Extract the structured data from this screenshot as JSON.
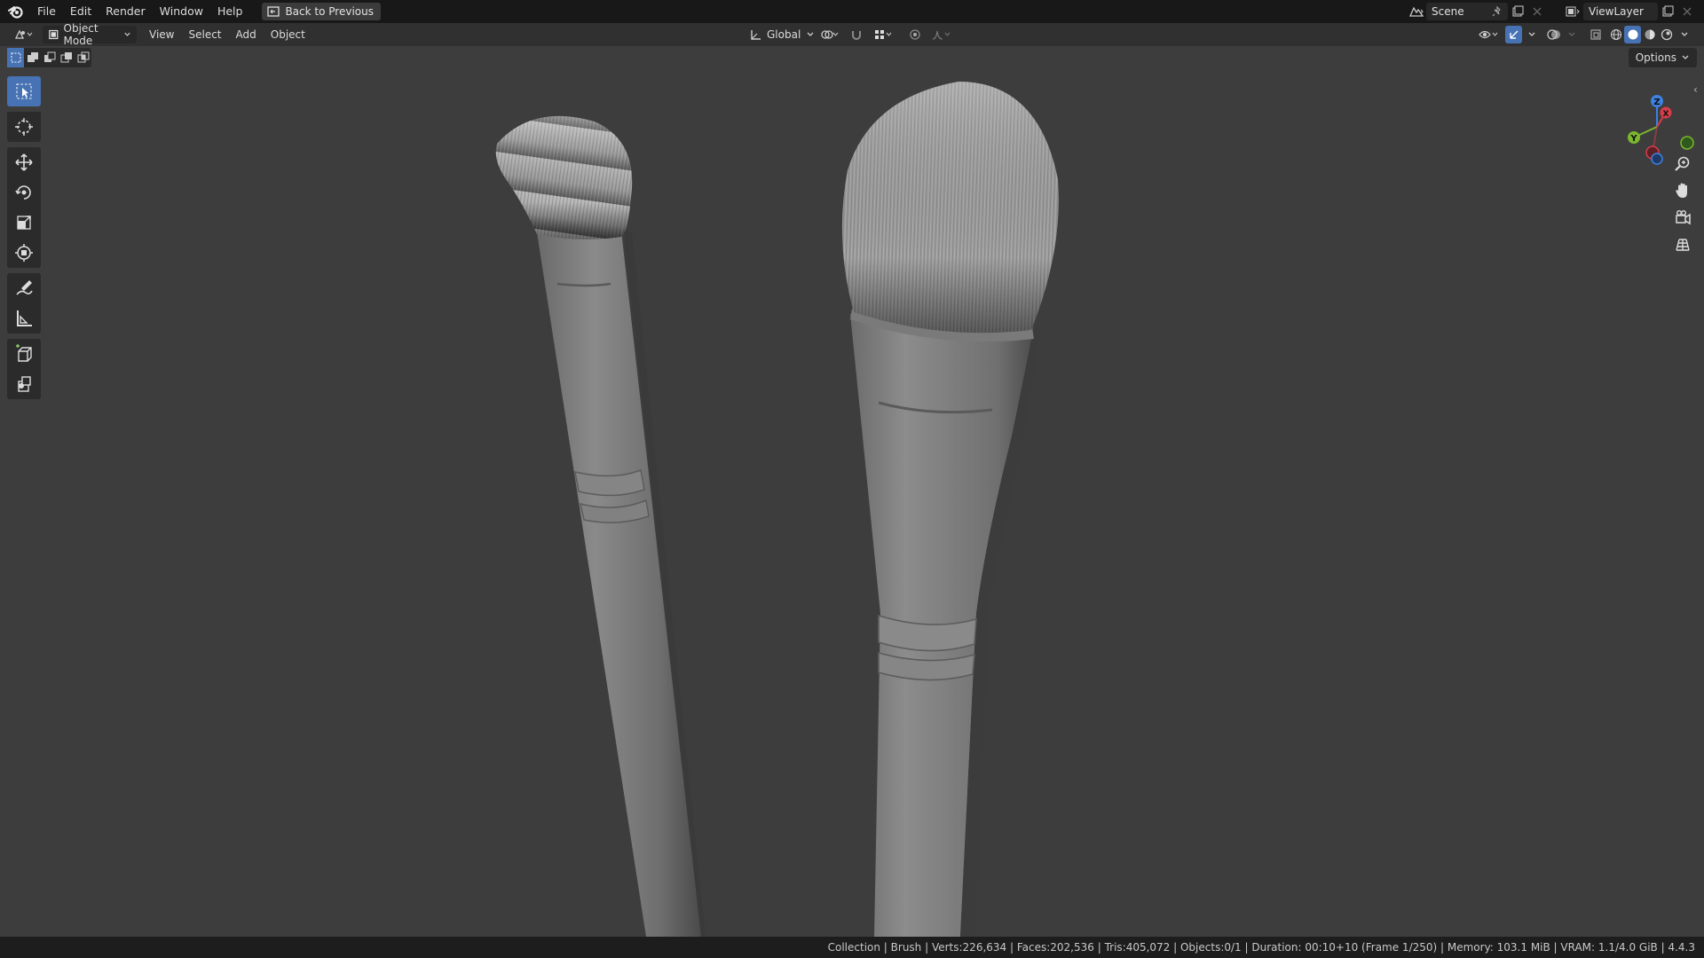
{
  "topbar": {
    "menus": [
      "File",
      "Edit",
      "Render",
      "Window",
      "Help"
    ],
    "back_button": "Back to Previous",
    "scene_name": "Scene",
    "view_layer_name": "ViewLayer"
  },
  "viewport_header": {
    "mode": "Object Mode",
    "menus": [
      "View",
      "Select",
      "Add",
      "Object"
    ],
    "transform_orientation": "Global",
    "options_label": "Options"
  },
  "gizmo": {
    "axes": [
      "Z",
      "Y",
      "X"
    ],
    "colors": {
      "x": "#d63d4a",
      "y": "#7bb62d",
      "z": "#3d82e0"
    }
  },
  "status": {
    "text": "Collection | Brush | Verts:226,634 | Faces:202,536 | Tris:405,072 | Objects:0/1 | Duration: 00:10+10 (Frame 1/250) | Memory: 103.1 MiB | VRAM: 1.1/4.0 GiB | 4.4.3"
  },
  "colors": {
    "accent": "#4772b3",
    "viewport_bg": "#3d3d3d"
  },
  "icons": {
    "toolbar": [
      "select-box-icon",
      "cursor-icon",
      "move-icon",
      "rotate-icon",
      "scale-icon",
      "transform-icon",
      "annotate-icon",
      "measure-icon",
      "add-cube-icon",
      "add-primitive-icon"
    ],
    "navigation": [
      "zoom-icon",
      "hand-pan-icon",
      "camera-view-icon",
      "grid-ortho-icon"
    ]
  }
}
